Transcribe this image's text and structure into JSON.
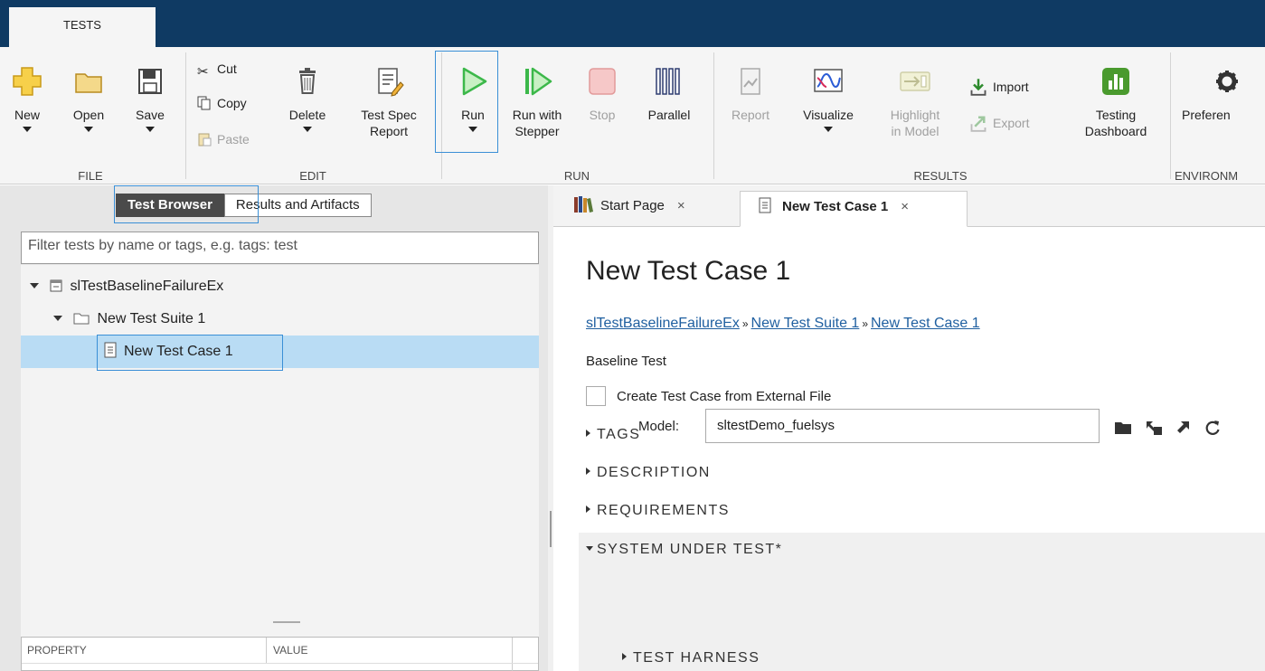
{
  "app": {
    "tab_label": "TESTS"
  },
  "ribbon": {
    "file": {
      "title": "FILE",
      "new_label": "New",
      "open_label": "Open",
      "save_label": "Save"
    },
    "edit": {
      "title": "EDIT",
      "cut_label": "Cut",
      "copy_label": "Copy",
      "paste_label": "Paste",
      "delete_label": "Delete",
      "test_spec_label_1": "Test Spec",
      "test_spec_label_2": "Report"
    },
    "run": {
      "title": "RUN",
      "run_label": "Run",
      "run_stepper_label_1": "Run with",
      "run_stepper_label_2": "Stepper",
      "stop_label": "Stop",
      "parallel_label": "Parallel"
    },
    "results": {
      "title": "RESULTS",
      "report_label": "Report",
      "visualize_label": "Visualize",
      "highlight_label_1": "Highlight",
      "highlight_label_2": "in Model",
      "import_label": "Import",
      "export_label": "Export",
      "dashboard_label_1": "Testing",
      "dashboard_label_2": "Dashboard"
    },
    "environment": {
      "title": "ENVIRONM",
      "preferences_label": "Preferen"
    },
    "colors": {
      "run_green": "#3cb84a",
      "disabled": "#a0a0a0",
      "highlight_blue": "#3a8fd6",
      "dashboard_green": "#4a9a2e"
    }
  },
  "left_panel": {
    "tab_test_browser": "Test Browser",
    "tab_results": "Results and Artifacts",
    "filter_placeholder": "Filter tests by name or tags, e.g. tags: test",
    "tree": {
      "file_node": "slTestBaselineFailureEx",
      "suite_node": "New Test Suite 1",
      "case_node": "New Test Case 1"
    },
    "properties": {
      "col_property": "PROPERTY",
      "col_value": "VALUE"
    }
  },
  "right_panel": {
    "tabs": {
      "start_page": "Start Page",
      "test_case": "New Test Case 1",
      "close": "×"
    },
    "title": "New Test Case 1",
    "breadcrumb": {
      "file": "slTestBaselineFailureEx",
      "suite": "New Test Suite 1",
      "case": "New Test Case 1",
      "separator": "»"
    },
    "test_type": "Baseline Test",
    "external_file_label": "Create Test Case from External File",
    "sections": {
      "tags": "TAGS",
      "description": "DESCRIPTION",
      "requirements": "REQUIREMENTS",
      "system_under_test": "SYSTEM UNDER TEST*",
      "test_harness": "TEST HARNESS"
    },
    "model": {
      "label": "Model:",
      "value": "sltestDemo_fuelsys"
    }
  }
}
